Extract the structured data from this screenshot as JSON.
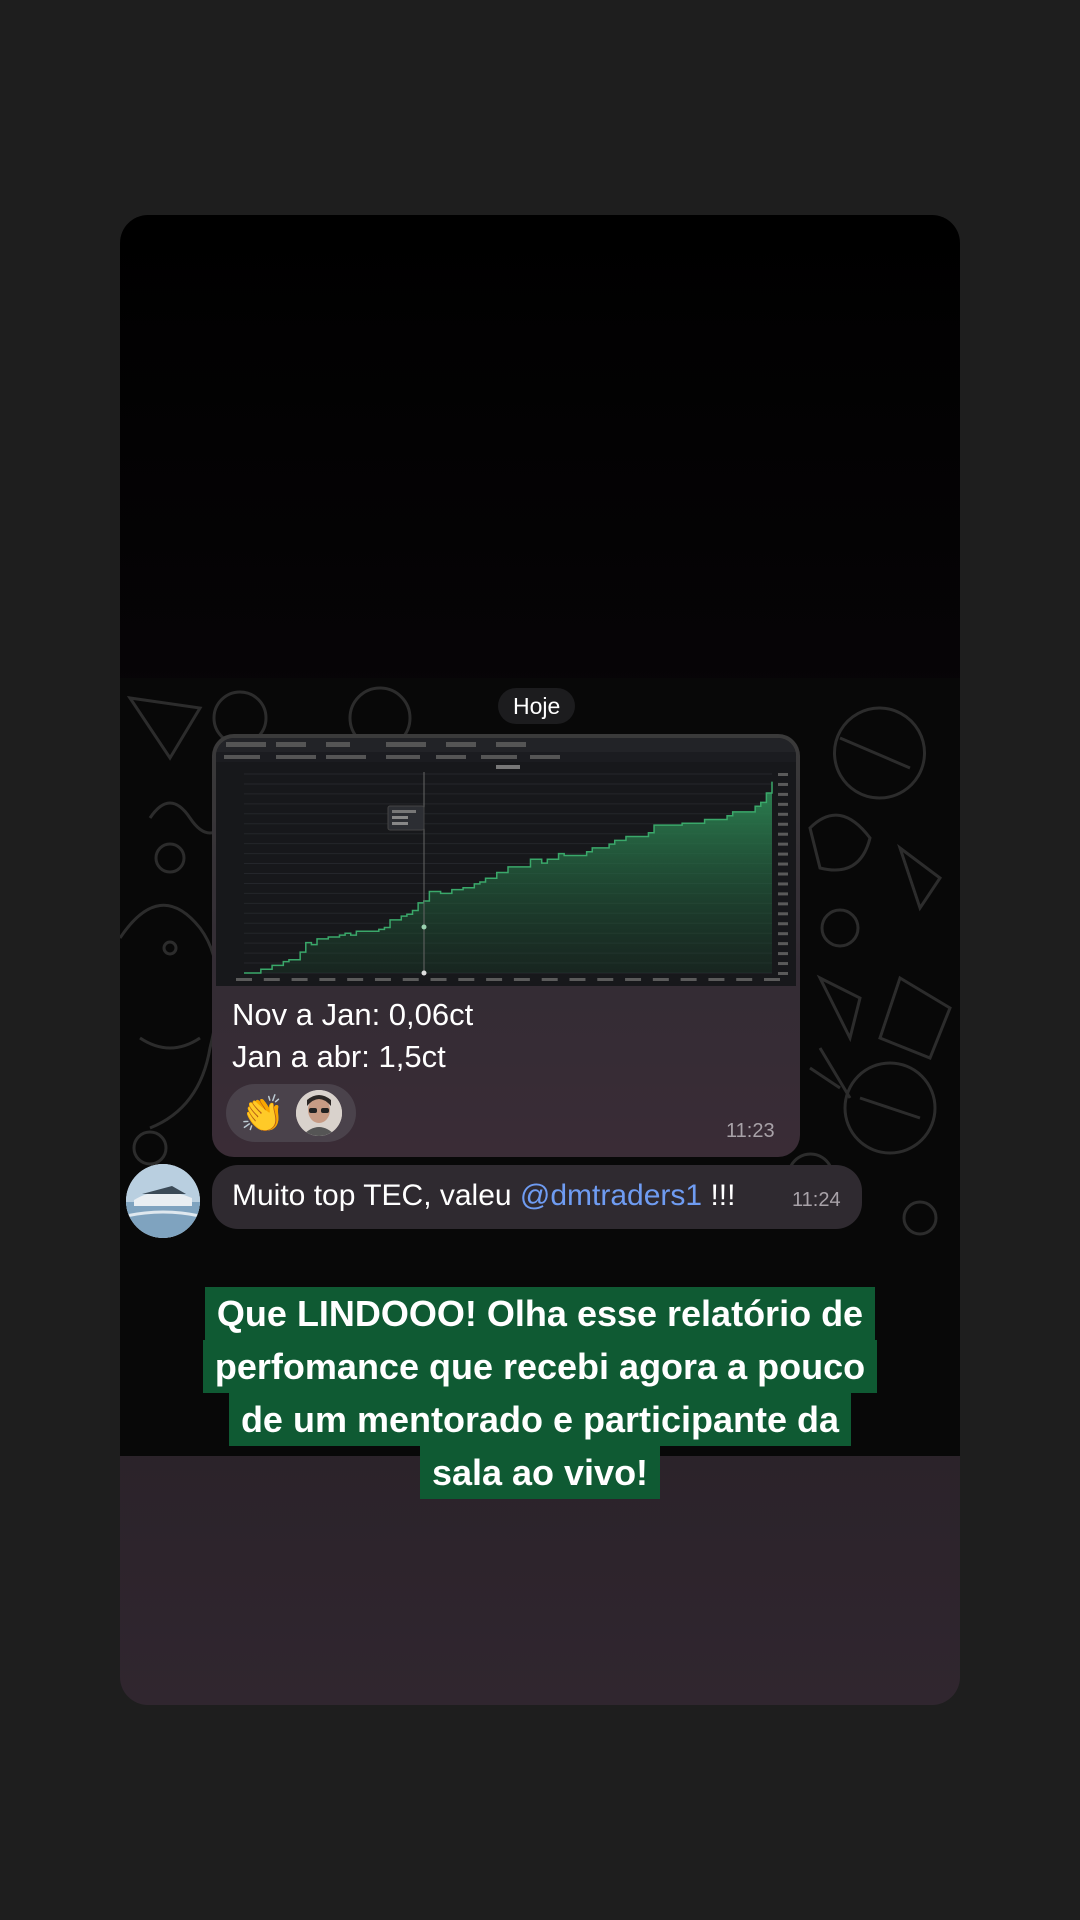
{
  "chat": {
    "date_label": "Hoje",
    "message_main": {
      "line1": "Nov a Jan: 0,06ct",
      "line2": "Jan a abr: 1,5ct",
      "time": "11:23",
      "reactions": [
        {
          "icon": "clapping-hands-icon",
          "glyph": "👏"
        },
        {
          "icon": "reactor-avatar"
        }
      ]
    },
    "message_reply": {
      "text": "Muito top TEC, valeu ",
      "mention": "@dmtraders1",
      "suffix": " !!!",
      "time": "11:24"
    }
  },
  "chart_data": {
    "type": "area",
    "color": "#2e8b57",
    "x": [
      0,
      5,
      10,
      15,
      20,
      25,
      30,
      35,
      40,
      45,
      50,
      55,
      60,
      65,
      70,
      75,
      80,
      85,
      90,
      95,
      100,
      105,
      110,
      115,
      120,
      125,
      130,
      135,
      140,
      145,
      150,
      155,
      160,
      165,
      170,
      175,
      180,
      185,
      190,
      195,
      200,
      205,
      210,
      215,
      220,
      225,
      230,
      235,
      240,
      245,
      250,
      255,
      260,
      265,
      270,
      275,
      280,
      285,
      290,
      295,
      300,
      305,
      310,
      315,
      320,
      325,
      330,
      335,
      340,
      345,
      350,
      355,
      360,
      365,
      370,
      375,
      380,
      385,
      390,
      395,
      400,
      405,
      410,
      415,
      420,
      425,
      430,
      435,
      440,
      445,
      450,
      455,
      460,
      465,
      470
    ],
    "values": [
      0,
      0,
      0,
      0.4,
      0.4,
      0.8,
      0.8,
      1.2,
      1.4,
      1.4,
      2.2,
      3.2,
      3.0,
      3.6,
      3.6,
      3.8,
      3.8,
      4.0,
      4.2,
      4.0,
      4.4,
      4.4,
      4.4,
      4.4,
      4.6,
      4.8,
      5.6,
      5.6,
      6.0,
      6.2,
      6.6,
      7.4,
      7.6,
      8.6,
      8.6,
      8.4,
      8.4,
      8.8,
      8.8,
      9.0,
      9.0,
      9.4,
      9.6,
      10.0,
      10.0,
      10.6,
      10.6,
      11.2,
      11.2,
      11.2,
      11.2,
      12.0,
      12.0,
      11.6,
      12.0,
      12.0,
      12.6,
      12.4,
      12.4,
      12.4,
      12.4,
      12.8,
      13.2,
      13.2,
      13.2,
      13.6,
      14.0,
      14.0,
      14.4,
      14.4,
      14.4,
      14.4,
      14.8,
      15.6,
      15.6,
      15.6,
      15.6,
      15.6,
      15.8,
      15.8,
      15.8,
      15.8,
      16.2,
      16.2,
      16.2,
      16.2,
      16.6,
      17.0,
      17.0,
      17.0,
      17.0,
      17.6,
      18.0,
      19.0,
      20.2
    ],
    "ylim": [
      0,
      21
    ]
  },
  "caption": {
    "lines": [
      "Que LINDOOO! Olha esse relatório de",
      "perfomance que recebi agora a pouco",
      "de um mentorado e participante da",
      "sala ao vivo!"
    ]
  }
}
